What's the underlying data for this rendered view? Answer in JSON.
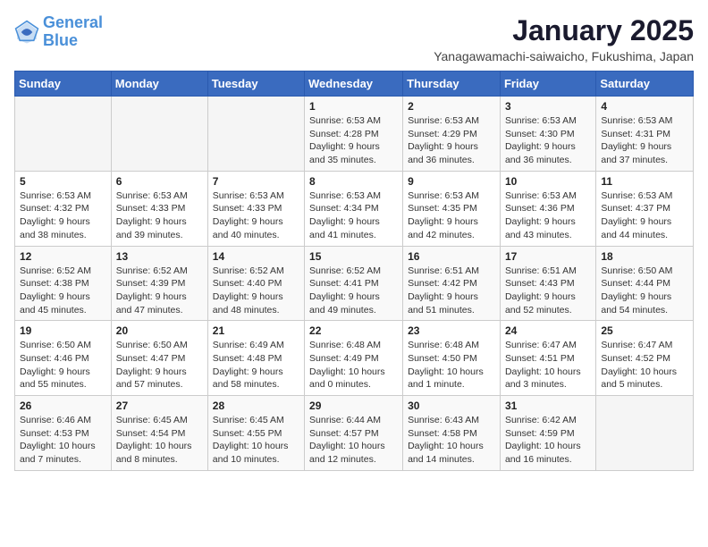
{
  "logo": {
    "text_general": "General",
    "text_blue": "Blue"
  },
  "title": "January 2025",
  "subtitle": "Yanagawamachi-saiwaicho, Fukushima, Japan",
  "weekdays": [
    "Sunday",
    "Monday",
    "Tuesday",
    "Wednesday",
    "Thursday",
    "Friday",
    "Saturday"
  ],
  "weeks": [
    [
      {
        "day": "",
        "info": ""
      },
      {
        "day": "",
        "info": ""
      },
      {
        "day": "",
        "info": ""
      },
      {
        "day": "1",
        "info": "Sunrise: 6:53 AM\nSunset: 4:28 PM\nDaylight: 9 hours and 35 minutes."
      },
      {
        "day": "2",
        "info": "Sunrise: 6:53 AM\nSunset: 4:29 PM\nDaylight: 9 hours and 36 minutes."
      },
      {
        "day": "3",
        "info": "Sunrise: 6:53 AM\nSunset: 4:30 PM\nDaylight: 9 hours and 36 minutes."
      },
      {
        "day": "4",
        "info": "Sunrise: 6:53 AM\nSunset: 4:31 PM\nDaylight: 9 hours and 37 minutes."
      }
    ],
    [
      {
        "day": "5",
        "info": "Sunrise: 6:53 AM\nSunset: 4:32 PM\nDaylight: 9 hours and 38 minutes."
      },
      {
        "day": "6",
        "info": "Sunrise: 6:53 AM\nSunset: 4:33 PM\nDaylight: 9 hours and 39 minutes."
      },
      {
        "day": "7",
        "info": "Sunrise: 6:53 AM\nSunset: 4:33 PM\nDaylight: 9 hours and 40 minutes."
      },
      {
        "day": "8",
        "info": "Sunrise: 6:53 AM\nSunset: 4:34 PM\nDaylight: 9 hours and 41 minutes."
      },
      {
        "day": "9",
        "info": "Sunrise: 6:53 AM\nSunset: 4:35 PM\nDaylight: 9 hours and 42 minutes."
      },
      {
        "day": "10",
        "info": "Sunrise: 6:53 AM\nSunset: 4:36 PM\nDaylight: 9 hours and 43 minutes."
      },
      {
        "day": "11",
        "info": "Sunrise: 6:53 AM\nSunset: 4:37 PM\nDaylight: 9 hours and 44 minutes."
      }
    ],
    [
      {
        "day": "12",
        "info": "Sunrise: 6:52 AM\nSunset: 4:38 PM\nDaylight: 9 hours and 45 minutes."
      },
      {
        "day": "13",
        "info": "Sunrise: 6:52 AM\nSunset: 4:39 PM\nDaylight: 9 hours and 47 minutes."
      },
      {
        "day": "14",
        "info": "Sunrise: 6:52 AM\nSunset: 4:40 PM\nDaylight: 9 hours and 48 minutes."
      },
      {
        "day": "15",
        "info": "Sunrise: 6:52 AM\nSunset: 4:41 PM\nDaylight: 9 hours and 49 minutes."
      },
      {
        "day": "16",
        "info": "Sunrise: 6:51 AM\nSunset: 4:42 PM\nDaylight: 9 hours and 51 minutes."
      },
      {
        "day": "17",
        "info": "Sunrise: 6:51 AM\nSunset: 4:43 PM\nDaylight: 9 hours and 52 minutes."
      },
      {
        "day": "18",
        "info": "Sunrise: 6:50 AM\nSunset: 4:44 PM\nDaylight: 9 hours and 54 minutes."
      }
    ],
    [
      {
        "day": "19",
        "info": "Sunrise: 6:50 AM\nSunset: 4:46 PM\nDaylight: 9 hours and 55 minutes."
      },
      {
        "day": "20",
        "info": "Sunrise: 6:50 AM\nSunset: 4:47 PM\nDaylight: 9 hours and 57 minutes."
      },
      {
        "day": "21",
        "info": "Sunrise: 6:49 AM\nSunset: 4:48 PM\nDaylight: 9 hours and 58 minutes."
      },
      {
        "day": "22",
        "info": "Sunrise: 6:48 AM\nSunset: 4:49 PM\nDaylight: 10 hours and 0 minutes."
      },
      {
        "day": "23",
        "info": "Sunrise: 6:48 AM\nSunset: 4:50 PM\nDaylight: 10 hours and 1 minute."
      },
      {
        "day": "24",
        "info": "Sunrise: 6:47 AM\nSunset: 4:51 PM\nDaylight: 10 hours and 3 minutes."
      },
      {
        "day": "25",
        "info": "Sunrise: 6:47 AM\nSunset: 4:52 PM\nDaylight: 10 hours and 5 minutes."
      }
    ],
    [
      {
        "day": "26",
        "info": "Sunrise: 6:46 AM\nSunset: 4:53 PM\nDaylight: 10 hours and 7 minutes."
      },
      {
        "day": "27",
        "info": "Sunrise: 6:45 AM\nSunset: 4:54 PM\nDaylight: 10 hours and 8 minutes."
      },
      {
        "day": "28",
        "info": "Sunrise: 6:45 AM\nSunset: 4:55 PM\nDaylight: 10 hours and 10 minutes."
      },
      {
        "day": "29",
        "info": "Sunrise: 6:44 AM\nSunset: 4:57 PM\nDaylight: 10 hours and 12 minutes."
      },
      {
        "day": "30",
        "info": "Sunrise: 6:43 AM\nSunset: 4:58 PM\nDaylight: 10 hours and 14 minutes."
      },
      {
        "day": "31",
        "info": "Sunrise: 6:42 AM\nSunset: 4:59 PM\nDaylight: 10 hours and 16 minutes."
      },
      {
        "day": "",
        "info": ""
      }
    ]
  ]
}
